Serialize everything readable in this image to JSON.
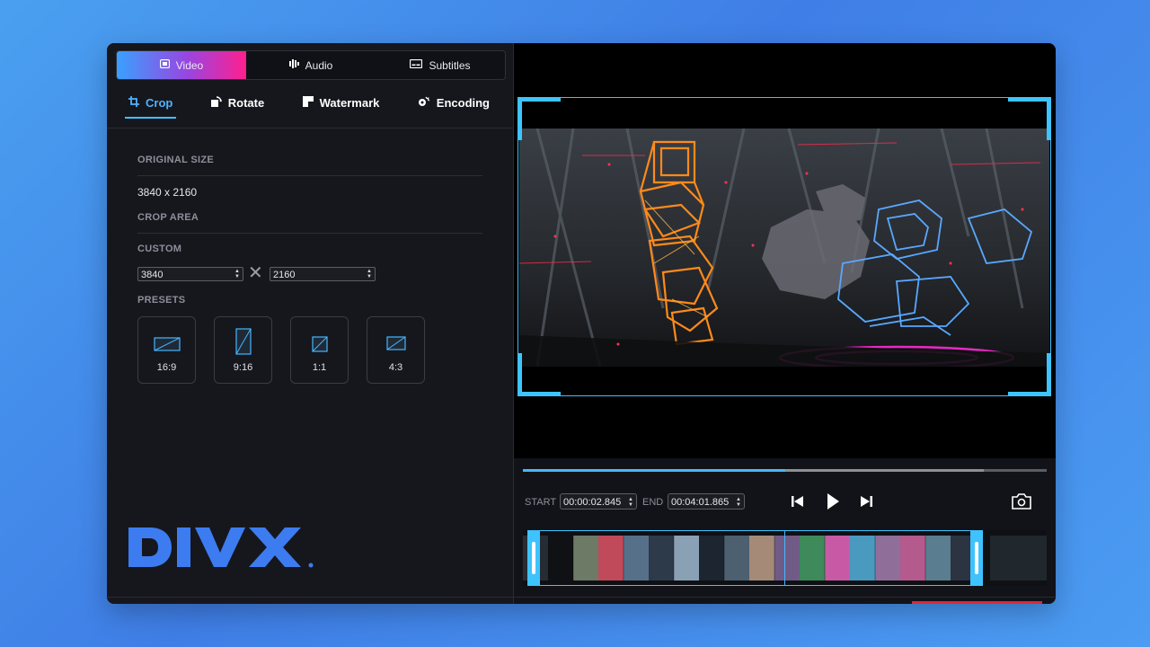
{
  "mode_tabs": [
    {
      "label": "Video",
      "icon": "video-icon",
      "active": true
    },
    {
      "label": "Audio",
      "icon": "audio-bars-icon",
      "active": false
    },
    {
      "label": "Subtitles",
      "icon": "subtitles-icon",
      "active": false
    }
  ],
  "tool_tabs": [
    {
      "label": "Crop",
      "icon": "crop-icon",
      "active": true
    },
    {
      "label": "Rotate",
      "icon": "rotate-icon",
      "active": false
    },
    {
      "label": "Watermark",
      "icon": "watermark-icon",
      "active": false
    },
    {
      "label": "Encoding",
      "icon": "encoding-icon",
      "active": false
    }
  ],
  "crop_panel": {
    "original_size_label": "ORIGINAL SIZE",
    "original_size_value": "3840 x 2160",
    "crop_area_label": "CROP AREA",
    "custom_label": "CUSTOM",
    "width_value": "3840",
    "height_value": "2160",
    "presets_label": "PRESETS",
    "presets": [
      "16:9",
      "9:16",
      "1:1",
      "4:3"
    ]
  },
  "brand": {
    "logo_text": "DIVX",
    "color": "#3d7cf0"
  },
  "playback": {
    "start_label": "START",
    "start_time": "00:00:02.845",
    "end_label": "END",
    "end_time": "00:04:01.865",
    "progress_fraction": 0.5,
    "buffered_fraction": 0.88
  },
  "colors": {
    "accent": "#3ec3ff",
    "active_tab_gradient": [
      "#3aa0ff",
      "#9a45e0",
      "#ff1f8e"
    ]
  }
}
